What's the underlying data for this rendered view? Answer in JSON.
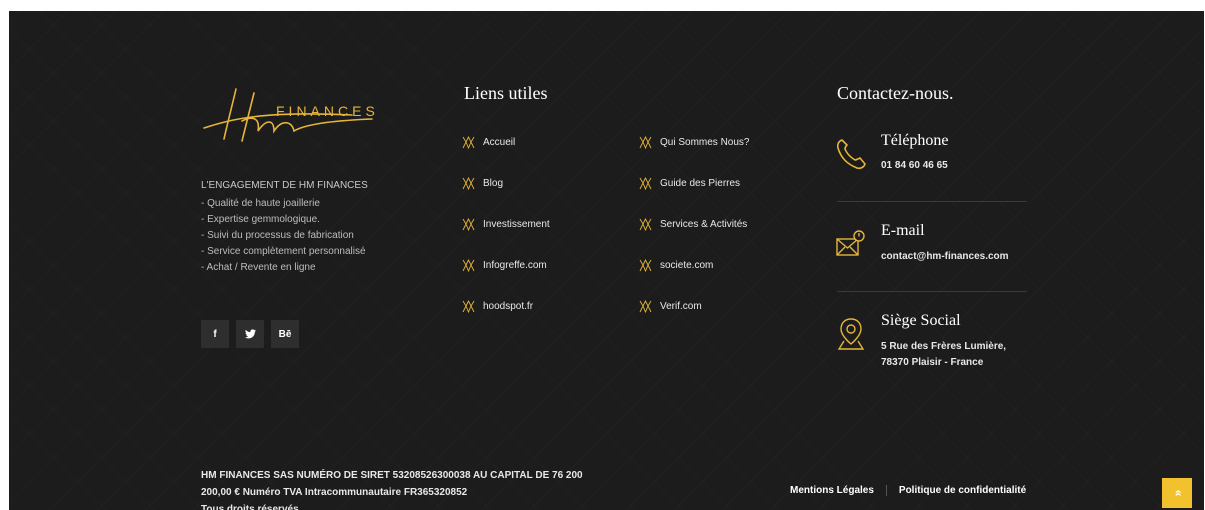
{
  "colors": {
    "accent": "#f2c12e",
    "background": "#1c1c1c"
  },
  "brand": {
    "logo_text": "FINANCES"
  },
  "about": {
    "title": "L'ENGAGEMENT DE HM FINANCES",
    "items": [
      "- Qualité de haute joaillerie",
      "- Expertise gemmologique.",
      "- Suivi du processus de fabrication",
      "- Service complètement personnalisé",
      "- Achat / Revente en ligne"
    ]
  },
  "social": [
    {
      "label": "f",
      "icon": "facebook-icon"
    },
    {
      "label": "🐦",
      "icon": "twitter-icon"
    },
    {
      "label": "Bē",
      "icon": "behance-icon"
    }
  ],
  "links": {
    "heading": "Liens utiles",
    "col1": [
      "Accueil",
      "Blog",
      "Investissement",
      "Infogreffe.com",
      "hoodspot.fr"
    ],
    "col2": [
      "Qui Sommes Nous?",
      "Guide des Pierres",
      "Services & Activités",
      "societe.com",
      "Verif.com"
    ]
  },
  "contact": {
    "heading": "Contactez-nous.",
    "phone": {
      "title": "Téléphone",
      "value": "01 84 60 46 65"
    },
    "email": {
      "title": "E-mail",
      "value": "contact@hm-finances.com"
    },
    "address": {
      "title": "Siège Social",
      "line1": "5 Rue des Frères Lumière,",
      "line2": "78370 Plaisir - France"
    }
  },
  "bottom": {
    "legal_line1": "HM FINANCES SAS NUMÉRO DE SIRET 53208526300038 AU CAPITAL DE 76 200",
    "legal_line2": "200,00 € Numéro TVA Intracommunautaire FR365320852",
    "legal_line3": "Tous droits réservés",
    "mentions": "Mentions Légales",
    "privacy": "Politique de confidentialité"
  },
  "totop": {
    "label": "»"
  }
}
